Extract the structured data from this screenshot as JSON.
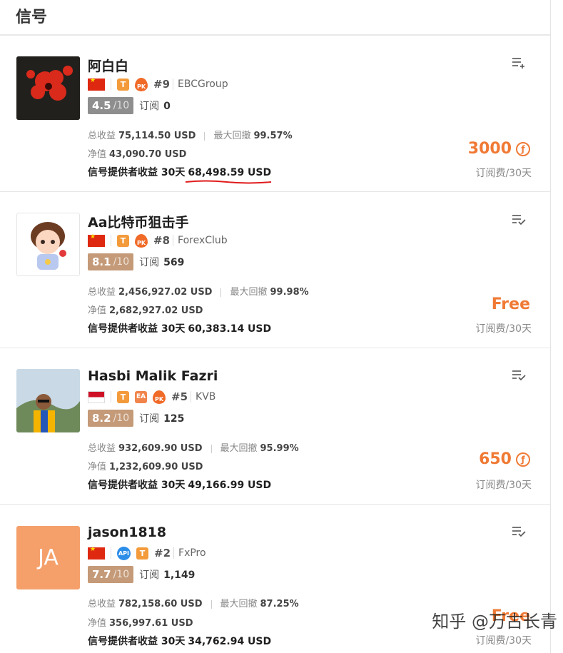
{
  "header": {
    "title": "信号"
  },
  "labels": {
    "total_income": "总收益",
    "max_drawdown": "最大回撤",
    "net_value": "净值",
    "provider_income": "信号提供者收益 30天",
    "subscribe": "订阅",
    "fee_unit": "订阅费/30天"
  },
  "cards": [
    {
      "name": "阿白白",
      "rank": "#9",
      "broker": "EBCGroup",
      "score": "4.5",
      "score_den": "/10",
      "subscribers": "0",
      "total_income": "75,114.50 USD",
      "max_drawdown": "99.57%",
      "net_value": "43,090.70 USD",
      "provider_income": "68,498.59 USD",
      "price": "3000",
      "tags": [
        "cn-flag",
        "T",
        "PK"
      ]
    },
    {
      "name": "Aa比特币狙击手",
      "rank": "#8",
      "broker": "ForexClub",
      "score": "8.1",
      "score_den": "/10",
      "subscribers": "569",
      "total_income": "2,456,927.02 USD",
      "max_drawdown": "99.98%",
      "net_value": "2,682,927.02 USD",
      "provider_income": "60,383.14 USD",
      "price": "Free",
      "tags": [
        "cn-flag",
        "T",
        "PK"
      ]
    },
    {
      "name": "Hasbi Malik Fazri",
      "rank": "#5",
      "broker": "KVB",
      "score": "8.2",
      "score_den": "/10",
      "subscribers": "125",
      "total_income": "932,609.90 USD",
      "max_drawdown": "95.99%",
      "net_value": "1,232,609.90 USD",
      "provider_income": "49,166.99 USD",
      "price": "650",
      "tags": [
        "id-flag",
        "T",
        "EA",
        "PK"
      ]
    },
    {
      "name": "jason1818",
      "avatar_text": "JA",
      "rank": "#2",
      "broker": "FxPro",
      "score": "7.7",
      "score_den": "/10",
      "subscribers": "1,149",
      "total_income": "782,158.60 USD",
      "max_drawdown": "87.25%",
      "net_value": "356,997.61 USD",
      "provider_income": "34,762.94 USD",
      "price": "Free",
      "tags": [
        "cn-flag",
        "API",
        "T"
      ]
    }
  ],
  "tag_text": {
    "t": "T",
    "ea": "EA",
    "api": "API",
    "pk": "PK",
    "coin": "ƒ"
  },
  "watermark": "知乎 @万古长青",
  "colors": {
    "accent": "#f07a35",
    "tag_orange": "#f39a3b",
    "score_gray": "#8e8e8e",
    "score_tan": "#c49a78",
    "avatar_ja": "#f5a06a",
    "underline_red": "#e01b1b"
  }
}
